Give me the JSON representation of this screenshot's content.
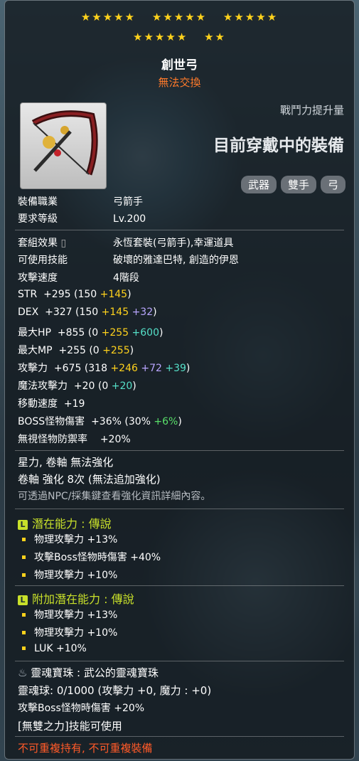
{
  "stars": {
    "row1": [
      "★★★★★",
      "★★★★★",
      "★★★★★"
    ],
    "row2": [
      "★★★★★",
      "★★"
    ]
  },
  "item": {
    "name": "創世弓",
    "untradable": "無法交換"
  },
  "combat_power_label": "戰鬥力提升量",
  "equipped_label": "目前穿戴中的裝備",
  "tags": [
    "武器",
    "雙手",
    "弓"
  ],
  "req": [
    {
      "label": "裝備職業",
      "value": "弓箭手"
    },
    {
      "label": "要求等級",
      "value": "Lv.200"
    }
  ],
  "info": [
    {
      "label": "套組效果",
      "value": "永恆套裝(弓箭手),幸運道具"
    },
    {
      "label": "可使用技能",
      "value": "破壞的雅達巴特, 創造的伊恩"
    },
    {
      "label": "攻擊速度",
      "value": "4階段"
    }
  ],
  "stats": {
    "str": {
      "label": "STR",
      "total": "+295",
      "open": "(150",
      "a": "+145",
      "close": ")"
    },
    "dex": {
      "label": "DEX",
      "total": "+327",
      "open": "(150",
      "a": "+145",
      "b": "+32",
      "close": ")"
    },
    "hp": {
      "label": "最大HP",
      "total": "+855",
      "open": "(0",
      "a": "+255",
      "b": "+600",
      "close": ")"
    },
    "mp": {
      "label": "最大MP",
      "total": "+255",
      "open": "(0",
      "a": "+255",
      "close": ")"
    },
    "atk": {
      "label": "攻擊力",
      "total": "+675",
      "open": "(318",
      "a": "+246",
      "b": "+72",
      "c": "+39",
      "close": ")"
    },
    "matk": {
      "label": "魔法攻擊力",
      "total": "+20",
      "open": "(0",
      "a": "+20",
      "close": ")"
    },
    "speed": {
      "label": "移動速度",
      "total": "+19"
    },
    "boss": {
      "label": "BOSS怪物傷害",
      "total": "+36%",
      "open": "(30%",
      "a": "+6%",
      "close": ")"
    },
    "ied": {
      "label": "無視怪物防禦率",
      "total": "+20%"
    }
  },
  "enhance": {
    "line1": "星力, 卷軸 無法強化",
    "line2": "卷軸 強化 8次 (無法追加強化)",
    "line3": "可透過NPC/採集鍵查看強化資訊詳細內容。"
  },
  "potential": {
    "badge": "L",
    "title": "潛在能力 : 傳說",
    "lines": [
      "物理攻擊力 +13%",
      "攻擊Boss怪物時傷害 +40%",
      "物理攻擊力 +10%"
    ]
  },
  "bonus_potential": {
    "badge": "L",
    "title": "附加潛在能力 : 傳說",
    "lines": [
      "物理攻擊力 +13%",
      "物理攻擊力 +10%",
      "LUK +10%"
    ]
  },
  "soul": {
    "title": "靈魂寶珠 : 武公的靈魂寶珠",
    "line1": "靈魂球: 0/1000 (攻擊力 +0, 魔力 : +0)",
    "line2": "攻擊Boss怪物時傷害 +20%",
    "line3": "[無雙之力]技能可使用"
  },
  "footer": "不可重複持有, 不可重複裝備",
  "colors": {
    "gold": "#ffd21c",
    "orange": "#ff7a2a",
    "cyan": "#55e0c8",
    "purple": "#b9a6ff",
    "green": "#59e06a",
    "lime": "#c8e02a",
    "red": "#ff5a28"
  }
}
